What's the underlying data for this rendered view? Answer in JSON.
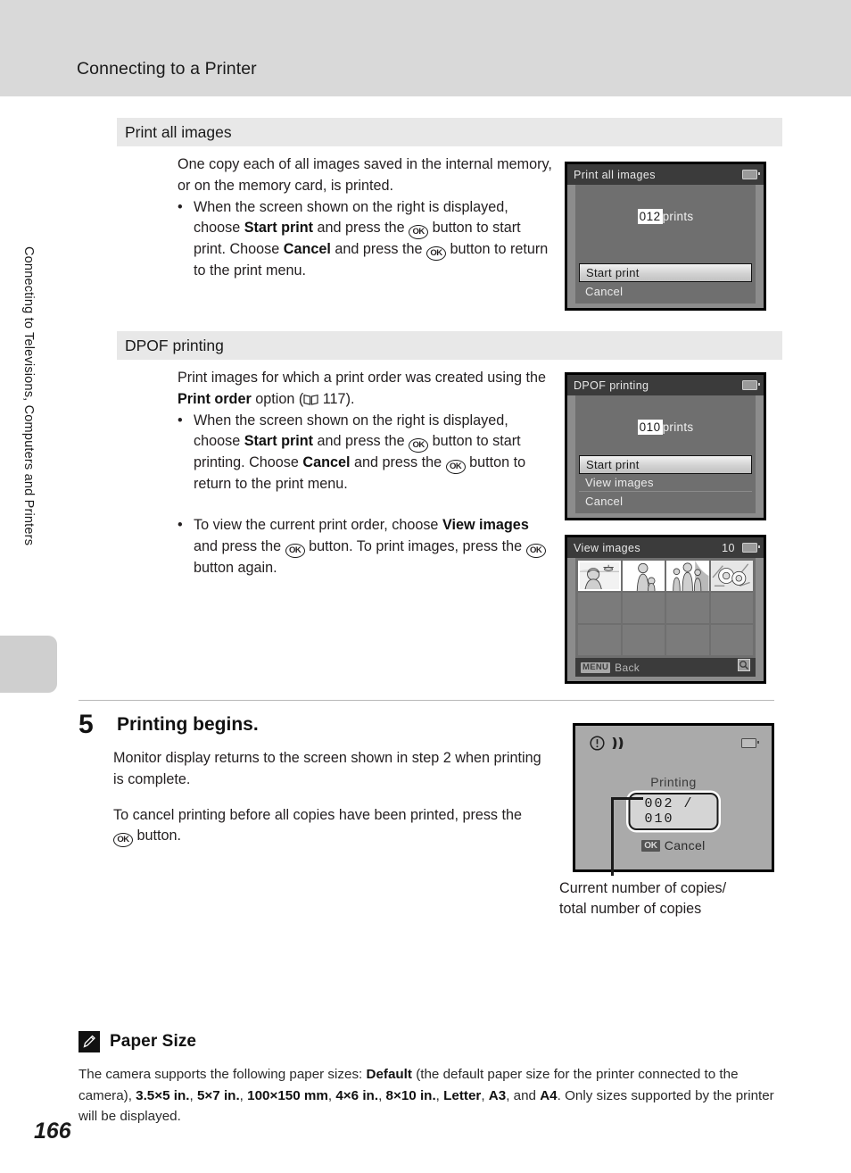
{
  "header": {
    "title": "Connecting to a Printer"
  },
  "sidebar": {
    "chapter_label": "Connecting to Televisions, Computers and Printers"
  },
  "page": {
    "number": "166"
  },
  "sections": [
    {
      "id": "print-all-images",
      "heading": "Print all images",
      "intro": "One copy each of all images saved in the internal memory, or on the memory card, is printed.",
      "bullets": [
        {
          "pre": "When the screen shown on the right is displayed, choose ",
          "bold1": "Start print",
          "mid1": " and press the ",
          "ok1": "OK",
          "mid2": " button to start print. Choose ",
          "bold2": "Cancel",
          "mid3": " and press the ",
          "ok2": "OK",
          "post": " button to return to the print menu."
        }
      ]
    },
    {
      "id": "dpof-printing",
      "heading": "DPOF printing",
      "intro_pre": "Print images for which a print order was created using the ",
      "intro_bold": "Print order",
      "intro_mid": " option (",
      "intro_page_ref": "117",
      "intro_post": ").",
      "bullets": [
        {
          "pre": "When the screen shown on the right is displayed, choose ",
          "bold1": "Start print",
          "mid1": " and press the ",
          "ok1": "OK",
          "mid2": " button to start printing. Choose ",
          "bold2": "Cancel",
          "mid3": " and press the ",
          "ok2": "OK",
          "post": " button to return to the print menu."
        },
        {
          "pre": "To view the current print order, choose ",
          "bold1": "View images",
          "mid1": " and press the ",
          "ok1": "OK",
          "mid2": " button. To print images, press the ",
          "ok2": "OK",
          "post": " button again."
        }
      ]
    }
  ],
  "screens": {
    "print_all_images": {
      "title": "Print all images",
      "count": "012",
      "count_unit": "prints",
      "menu": [
        {
          "label": "Start print",
          "selected": true
        },
        {
          "label": "Cancel",
          "selected": false
        }
      ],
      "battery_icon": "battery-icon"
    },
    "dpof_printing": {
      "title": "DPOF printing",
      "count": "010",
      "count_unit": "prints",
      "menu": [
        {
          "label": "Start print",
          "selected": true
        },
        {
          "label": "View images",
          "selected": false
        },
        {
          "label": "Cancel",
          "selected": false
        }
      ],
      "battery_icon": "battery-icon"
    },
    "view_images": {
      "title": "View images",
      "count": "10",
      "battery_icon": "battery-icon",
      "menu_badge": "MENU",
      "back_label": "Back",
      "zoom_icon": "magnifier-icon",
      "thumbnails": [
        {
          "name": "thumb-girl-beach",
          "selected": true
        },
        {
          "name": "thumb-woman-child",
          "selected": false
        },
        {
          "name": "thumb-family",
          "selected": false
        },
        {
          "name": "thumb-flowers",
          "selected": false
        }
      ]
    },
    "printing": {
      "warning_icon": "exclamation-circle-icon",
      "shake_icon": "camera-shake-icon",
      "battery_icon": "battery-icon",
      "status_label": "Printing",
      "counter": "002 / 010",
      "ok_badge": "OK",
      "cancel_label": "Cancel"
    }
  },
  "callout": {
    "line1": "Current number of copies/",
    "line2": "total number of copies"
  },
  "step5": {
    "number": "5",
    "title": "Printing begins.",
    "paragraph1": "Monitor display returns to the screen shown in step 2 when printing is complete.",
    "paragraph2_pre": "To cancel printing before all copies have been printed, press the ",
    "paragraph2_ok": "OK",
    "paragraph2_post": " button."
  },
  "note": {
    "icon": "pencil-note-icon",
    "title": "Paper Size",
    "text_pre": "The camera supports the following paper sizes: ",
    "b_default": "Default",
    "text_mid1": " (the default paper size for the printer connected to the camera), ",
    "b_1": "3.5×5 in.",
    "sep1": ", ",
    "b_2": "5×7 in.",
    "sep2": ", ",
    "b_3": "100×150 mm",
    "sep3": ", ",
    "b_4": "4×6 in.",
    "sep4": ", ",
    "b_5": "8×10 in.",
    "sep5": ", ",
    "b_6": "Letter",
    "sep6": ", ",
    "b_7": "A3",
    "sep7": ", and ",
    "b_8": "A4",
    "text_post": ". Only sizes supported by the printer will be displayed."
  },
  "colors": {
    "header_band": "#d9d9d9",
    "section_bar": "#e8e8e8",
    "lcd_bezel": "#000000",
    "lcd_background": "#6f6f6f",
    "lcd_titlebar": "#3b3b3b",
    "accent_text": "#231f20"
  }
}
